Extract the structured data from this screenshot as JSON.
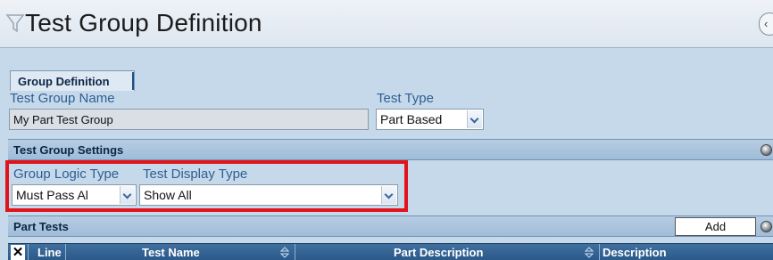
{
  "title": "Test Group Definition",
  "title_icons": {
    "filter": "funnel-icon",
    "collapse": "chevron-left-icon"
  },
  "tab": {
    "label": "Group Definition"
  },
  "fields": {
    "test_group_name": {
      "label": "Test Group Name",
      "value": "My Part Test Group"
    },
    "test_type": {
      "label": "Test Type",
      "value": "Part Based"
    }
  },
  "settings_section": {
    "title": "Test Group Settings",
    "group_logic_type": {
      "label": "Group Logic Type",
      "value": "Must Pass Al"
    },
    "test_display_type": {
      "label": "Test Display Type",
      "value": "Show All"
    }
  },
  "part_tests_section": {
    "title": "Part Tests",
    "add_label": "Add",
    "columns": [
      "Line",
      "Test Name",
      "Part Description",
      "Description"
    ]
  },
  "colors": {
    "highlight": "#e0141a",
    "header_bar": "#2b5a8a",
    "label_text": "#2d5e93"
  }
}
